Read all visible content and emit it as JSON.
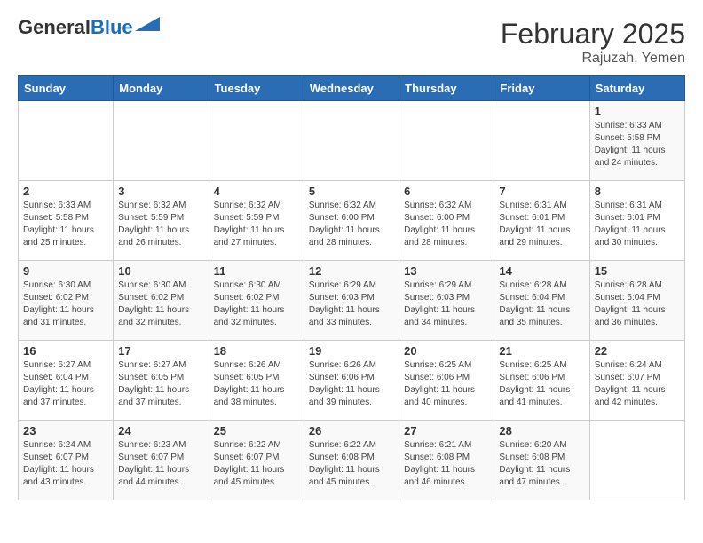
{
  "header": {
    "logo_general": "General",
    "logo_blue": "Blue",
    "title": "February 2025",
    "subtitle": "Rajuzah, Yemen"
  },
  "weekdays": [
    "Sunday",
    "Monday",
    "Tuesday",
    "Wednesday",
    "Thursday",
    "Friday",
    "Saturday"
  ],
  "weeks": [
    [
      {
        "day": "",
        "info": ""
      },
      {
        "day": "",
        "info": ""
      },
      {
        "day": "",
        "info": ""
      },
      {
        "day": "",
        "info": ""
      },
      {
        "day": "",
        "info": ""
      },
      {
        "day": "",
        "info": ""
      },
      {
        "day": "1",
        "info": "Sunrise: 6:33 AM\nSunset: 5:58 PM\nDaylight: 11 hours and 24 minutes."
      }
    ],
    [
      {
        "day": "2",
        "info": "Sunrise: 6:33 AM\nSunset: 5:58 PM\nDaylight: 11 hours and 25 minutes."
      },
      {
        "day": "3",
        "info": "Sunrise: 6:32 AM\nSunset: 5:59 PM\nDaylight: 11 hours and 26 minutes."
      },
      {
        "day": "4",
        "info": "Sunrise: 6:32 AM\nSunset: 5:59 PM\nDaylight: 11 hours and 27 minutes."
      },
      {
        "day": "5",
        "info": "Sunrise: 6:32 AM\nSunset: 6:00 PM\nDaylight: 11 hours and 28 minutes."
      },
      {
        "day": "6",
        "info": "Sunrise: 6:32 AM\nSunset: 6:00 PM\nDaylight: 11 hours and 28 minutes."
      },
      {
        "day": "7",
        "info": "Sunrise: 6:31 AM\nSunset: 6:01 PM\nDaylight: 11 hours and 29 minutes."
      },
      {
        "day": "8",
        "info": "Sunrise: 6:31 AM\nSunset: 6:01 PM\nDaylight: 11 hours and 30 minutes."
      }
    ],
    [
      {
        "day": "9",
        "info": "Sunrise: 6:30 AM\nSunset: 6:02 PM\nDaylight: 11 hours and 31 minutes."
      },
      {
        "day": "10",
        "info": "Sunrise: 6:30 AM\nSunset: 6:02 PM\nDaylight: 11 hours and 32 minutes."
      },
      {
        "day": "11",
        "info": "Sunrise: 6:30 AM\nSunset: 6:02 PM\nDaylight: 11 hours and 32 minutes."
      },
      {
        "day": "12",
        "info": "Sunrise: 6:29 AM\nSunset: 6:03 PM\nDaylight: 11 hours and 33 minutes."
      },
      {
        "day": "13",
        "info": "Sunrise: 6:29 AM\nSunset: 6:03 PM\nDaylight: 11 hours and 34 minutes."
      },
      {
        "day": "14",
        "info": "Sunrise: 6:28 AM\nSunset: 6:04 PM\nDaylight: 11 hours and 35 minutes."
      },
      {
        "day": "15",
        "info": "Sunrise: 6:28 AM\nSunset: 6:04 PM\nDaylight: 11 hours and 36 minutes."
      }
    ],
    [
      {
        "day": "16",
        "info": "Sunrise: 6:27 AM\nSunset: 6:04 PM\nDaylight: 11 hours and 37 minutes."
      },
      {
        "day": "17",
        "info": "Sunrise: 6:27 AM\nSunset: 6:05 PM\nDaylight: 11 hours and 37 minutes."
      },
      {
        "day": "18",
        "info": "Sunrise: 6:26 AM\nSunset: 6:05 PM\nDaylight: 11 hours and 38 minutes."
      },
      {
        "day": "19",
        "info": "Sunrise: 6:26 AM\nSunset: 6:06 PM\nDaylight: 11 hours and 39 minutes."
      },
      {
        "day": "20",
        "info": "Sunrise: 6:25 AM\nSunset: 6:06 PM\nDaylight: 11 hours and 40 minutes."
      },
      {
        "day": "21",
        "info": "Sunrise: 6:25 AM\nSunset: 6:06 PM\nDaylight: 11 hours and 41 minutes."
      },
      {
        "day": "22",
        "info": "Sunrise: 6:24 AM\nSunset: 6:07 PM\nDaylight: 11 hours and 42 minutes."
      }
    ],
    [
      {
        "day": "23",
        "info": "Sunrise: 6:24 AM\nSunset: 6:07 PM\nDaylight: 11 hours and 43 minutes."
      },
      {
        "day": "24",
        "info": "Sunrise: 6:23 AM\nSunset: 6:07 PM\nDaylight: 11 hours and 44 minutes."
      },
      {
        "day": "25",
        "info": "Sunrise: 6:22 AM\nSunset: 6:07 PM\nDaylight: 11 hours and 45 minutes."
      },
      {
        "day": "26",
        "info": "Sunrise: 6:22 AM\nSunset: 6:08 PM\nDaylight: 11 hours and 45 minutes."
      },
      {
        "day": "27",
        "info": "Sunrise: 6:21 AM\nSunset: 6:08 PM\nDaylight: 11 hours and 46 minutes."
      },
      {
        "day": "28",
        "info": "Sunrise: 6:20 AM\nSunset: 6:08 PM\nDaylight: 11 hours and 47 minutes."
      },
      {
        "day": "",
        "info": ""
      }
    ]
  ]
}
